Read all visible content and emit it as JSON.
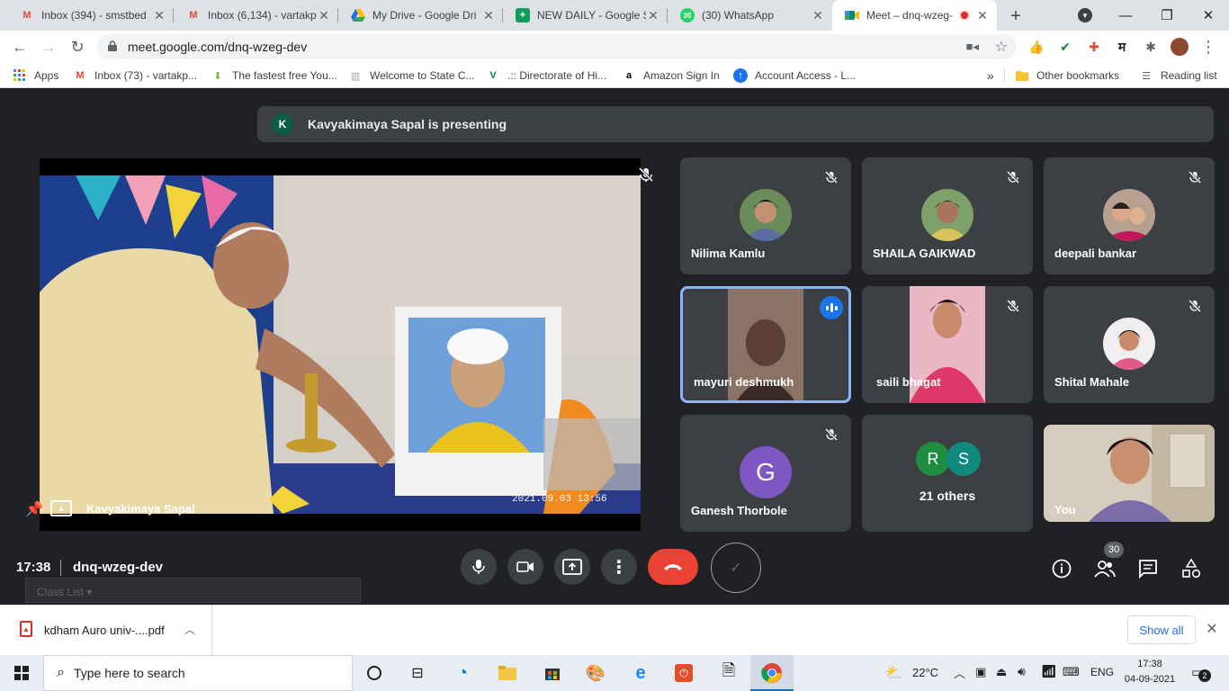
{
  "tabs": [
    {
      "title": "Inbox (394) - smstbed",
      "icon": "gmail-icon"
    },
    {
      "title": "Inbox (6,134) - vartakp",
      "icon": "gmail-icon"
    },
    {
      "title": "My Drive - Google Dri",
      "icon": "drive-icon"
    },
    {
      "title": "NEW DAILY - Google S",
      "icon": "sheets-icon"
    },
    {
      "title": "(30) WhatsApp",
      "icon": "whatsapp-icon",
      "badge": "30"
    },
    {
      "title": "Meet – dnq-wzeg-",
      "icon": "meet-icon",
      "active": true
    }
  ],
  "address": {
    "url": "meet.google.com/dnq-wzeg-dev"
  },
  "bookmarks": [
    {
      "label": "Apps",
      "icon": "apps-grid-icon"
    },
    {
      "label": "Inbox (73) - vartakp...",
      "icon": "gmail-icon"
    },
    {
      "label": "The fastest free You...",
      "icon": "download-arrow-icon"
    },
    {
      "label": "Welcome to State C...",
      "icon": "building-icon"
    },
    {
      "label": ".:: Directorate of Hi...",
      "icon": "v-logo-icon"
    },
    {
      "label": "Amazon Sign In",
      "icon": "amazon-icon"
    },
    {
      "label": "Account Access - L...",
      "icon": "account-icon"
    }
  ],
  "bookmarks_more": "»",
  "other_bookmarks": "Other bookmarks",
  "reading_list": "Reading list",
  "meet": {
    "banner": {
      "initial": "K",
      "text": "Kavyakimaya Sapal is presenting"
    },
    "presenter": {
      "name": "Kavyakimaya Sapal",
      "timestamp": "2021.09.03 13:56"
    },
    "participants": [
      {
        "name": "Nilima Kamlu",
        "muted": true
      },
      {
        "name": "SHAILA GAIKWAD",
        "muted": true
      },
      {
        "name": "deepali bankar",
        "muted": true
      },
      {
        "name": "mayuri deshmukh",
        "speaking": true
      },
      {
        "name": "saili bhagat",
        "muted": true
      },
      {
        "name": "Shital Mahale",
        "muted": true
      },
      {
        "name": "Ganesh Thorbole",
        "initial": "G",
        "muted": true
      },
      {
        "name": "21 others",
        "initials": [
          "R",
          "S"
        ]
      },
      {
        "name": "You"
      }
    ],
    "time": "17:38",
    "meeting_code": "dnq-wzeg-dev",
    "people_count": "30",
    "class_list": "Class List"
  },
  "download": {
    "file": "kdham Auro univ-....pdf",
    "show_all": "Show all"
  },
  "taskbar": {
    "search_placeholder": "Type here to search",
    "temperature": "22°C",
    "language": "ENG",
    "time": "17:38",
    "date": "04-09-2021",
    "notifications": "2"
  },
  "colors": {
    "meet_bg": "#202124",
    "tile_bg": "#3c4043",
    "end_call": "#ea4335",
    "speaking_border": "#8ab4f8",
    "g_avatar": "#7e57c2",
    "r_avatar": "#1e8e3e"
  }
}
